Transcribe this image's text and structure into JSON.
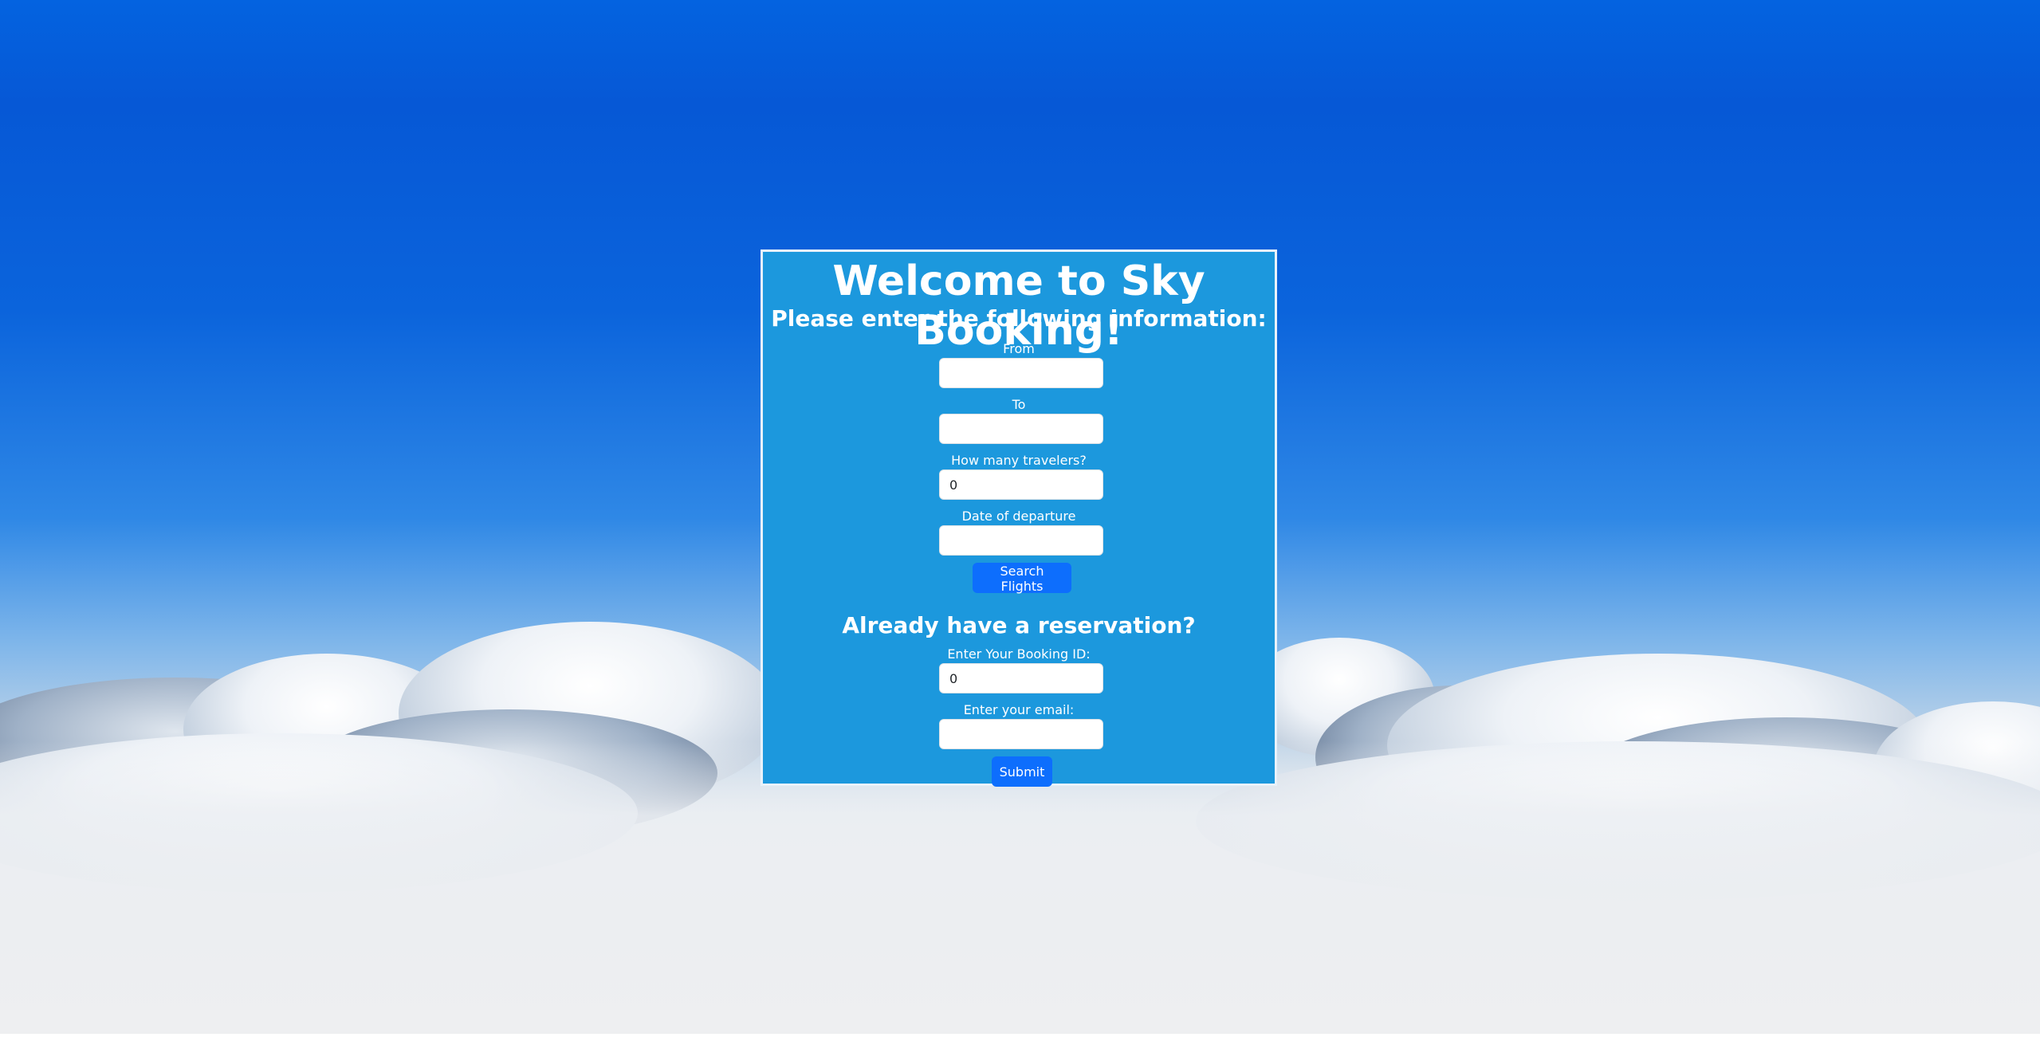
{
  "page": {
    "sky_color": "#0463e0",
    "cloud_color": "#eceef1"
  },
  "form": {
    "title": "Welcome to Sky Booking!",
    "subtitle": "Please enter the following information:",
    "from_label": "From",
    "from_value": "",
    "to_label": "To",
    "to_value": "",
    "travelers_label": "How many travelers?",
    "travelers_value": "0",
    "date_label": "Date of departure",
    "date_value": "",
    "search_button": "Search Flights",
    "panel_color": "#1c98dd",
    "button_color": "#0d6efd"
  },
  "reservation": {
    "heading": "Already have a reservation?",
    "booking_id_label": "Enter Your Booking ID:",
    "booking_id_value": "0",
    "email_label": "Enter your email:",
    "email_value": "",
    "submit_button": "Submit"
  }
}
